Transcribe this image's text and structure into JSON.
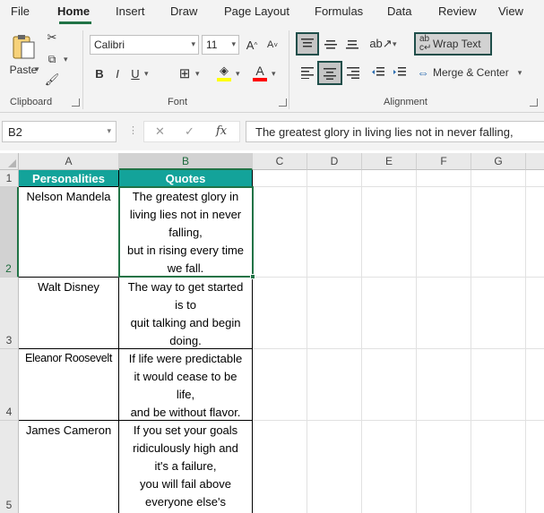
{
  "ribbon_tabs": [
    "File",
    "Home",
    "Insert",
    "Draw",
    "Page Layout",
    "Formulas",
    "Data",
    "Review",
    "View"
  ],
  "clipboard": {
    "paste_label": "Paste",
    "group_label": "Clipboard"
  },
  "font": {
    "name": "Calibri",
    "size": "11",
    "group_label": "Font",
    "bold": "B",
    "italic": "I",
    "underline": "U",
    "grow": "A^",
    "shrink": "A˅",
    "font_color": "A",
    "highlight_color": "#ffff00",
    "text_color": "#ff0000"
  },
  "alignment": {
    "wrap_text_label": "Wrap Text",
    "merge_label": "Merge & Center",
    "group_label": "Alignment"
  },
  "formula_bar": {
    "name_box": "B2",
    "cancel": "✕",
    "enter": "✓",
    "fx": "fx",
    "content": "The greatest glory in living lies not in never falling,"
  },
  "columns": [
    "A",
    "B",
    "C",
    "D",
    "E",
    "F",
    "G"
  ],
  "rows": [
    "1",
    "2",
    "3",
    "4",
    "5"
  ],
  "table": {
    "headers": [
      "Personalities",
      "Quotes"
    ],
    "rows": [
      {
        "name": "Nelson Mandela",
        "quote": [
          "The greatest glory in",
          "living lies not in never",
          "falling,",
          "but in rising every time",
          "we fall."
        ]
      },
      {
        "name": "Walt Disney",
        "quote": [
          "The way to get started",
          "is to",
          "quit talking and begin",
          "doing."
        ]
      },
      {
        "name": "Eleanor Roosevelt",
        "quote": [
          "If life were predictable",
          "it would cease to be",
          "life,",
          "and be without flavor."
        ]
      },
      {
        "name": "James Cameron",
        "quote": [
          "If you set your goals",
          "ridiculously high and",
          "it's a failure,",
          "you will fail above",
          "everyone else's"
        ]
      }
    ]
  },
  "colors": {
    "header_fill": "#13a39a",
    "accent": "#217346"
  }
}
